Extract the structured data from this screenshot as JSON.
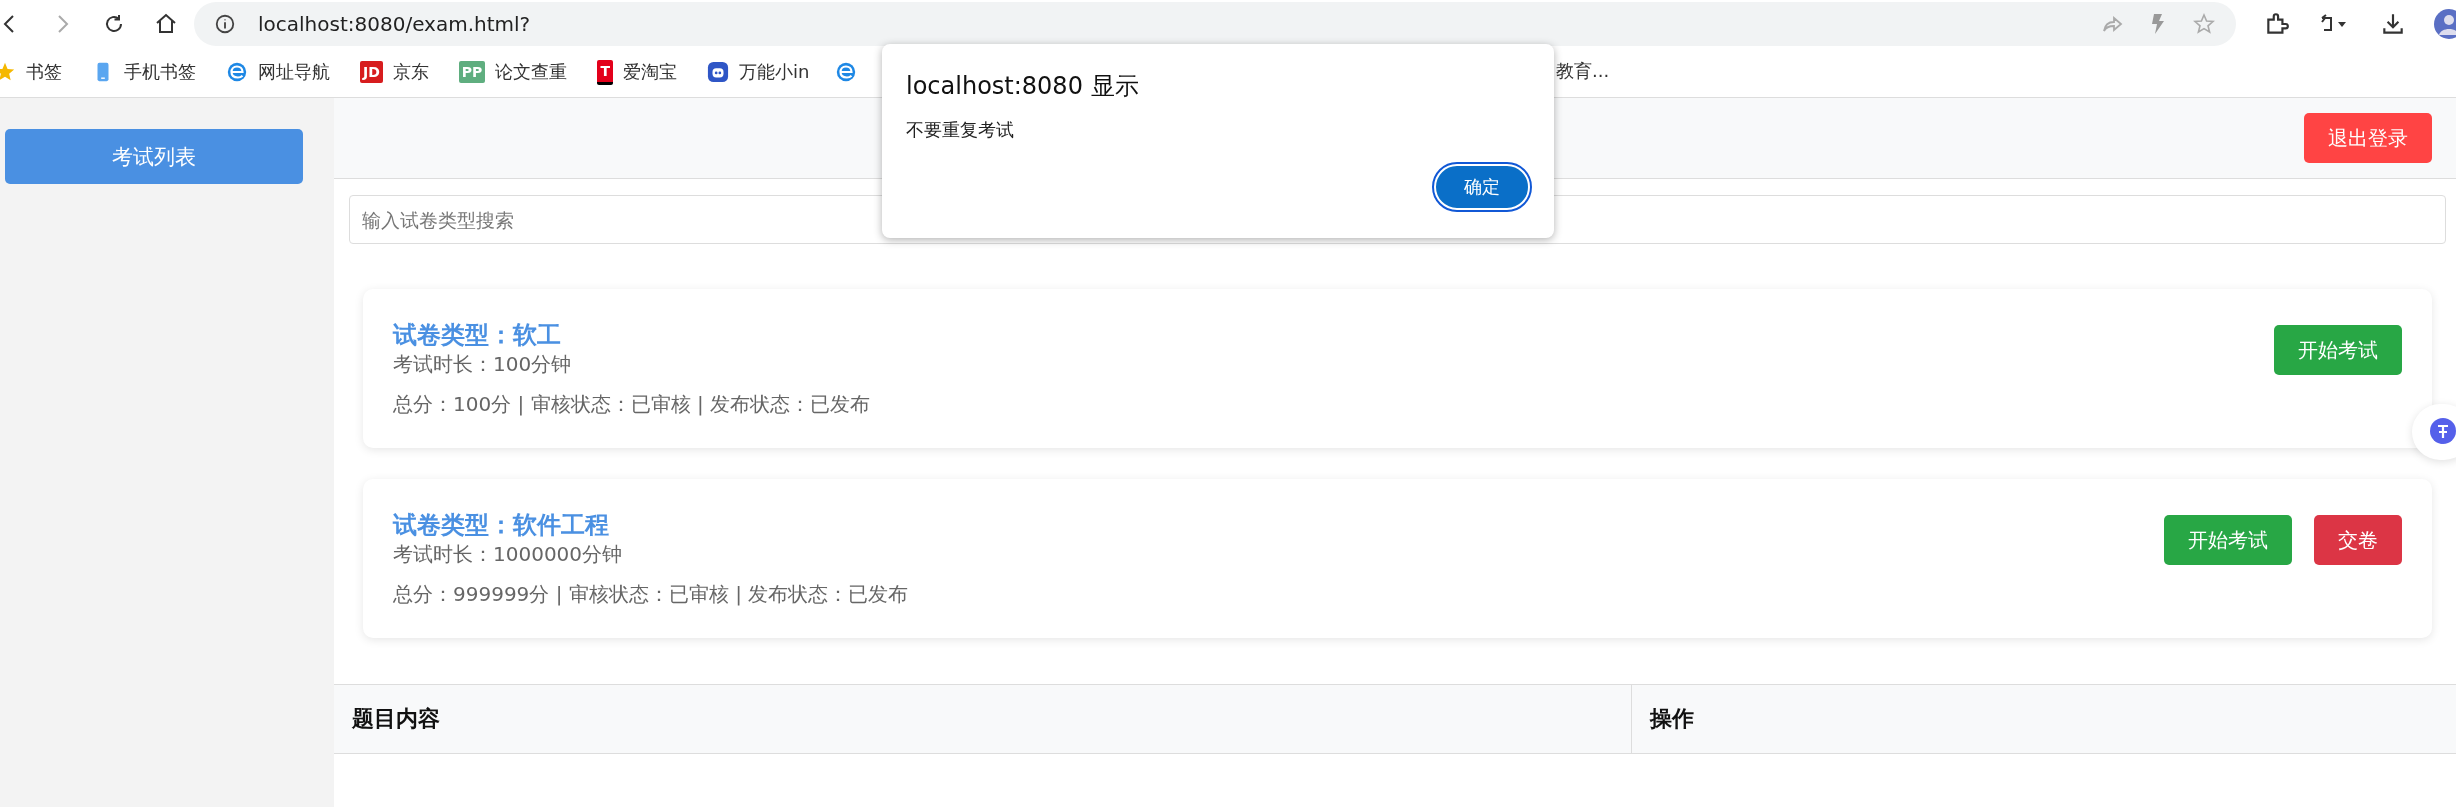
{
  "browser": {
    "url": "localhost:8080/exam.html?",
    "bookmarks": [
      {
        "label": "书签",
        "kind": "star"
      },
      {
        "label": "手机书签",
        "kind": "phone"
      },
      {
        "label": "网址导航",
        "kind": "edge"
      },
      {
        "label": "京东",
        "kind": "jd",
        "badge": "JD"
      },
      {
        "label": "论文查重",
        "kind": "pp",
        "badge": "PP"
      },
      {
        "label": "爱淘宝",
        "kind": "t",
        "badge": "T"
      },
      {
        "label": "万能小in",
        "kind": "robot"
      },
      {
        "label": "教育...",
        "kind": "edge"
      }
    ]
  },
  "dialog": {
    "title": "localhost:8080 显示",
    "message": "不要重复考试",
    "button": "确定"
  },
  "sidebar": {
    "items": [
      {
        "label": "考试列表",
        "selected": true
      }
    ]
  },
  "header": {
    "logout": "退出登录"
  },
  "search": {
    "placeholder": "输入试卷类型搜索"
  },
  "exams": [
    {
      "title": "试卷类型：软工",
      "duration": "考试时长：100分钟",
      "meta": "总分：100分 | 审核状态：已审核 | 发布状态：已发布",
      "buttons": [
        {
          "label": "开始考试",
          "kind": "start"
        }
      ]
    },
    {
      "title": "试卷类型：软件工程",
      "duration": "考试时长：1000000分钟",
      "meta": "总分：999999分 | 审核状态：已审核 | 发布状态：已发布",
      "buttons": [
        {
          "label": "开始考试",
          "kind": "start"
        },
        {
          "label": "交卷",
          "kind": "submit"
        }
      ]
    }
  ],
  "table": {
    "columns": [
      "题目内容",
      "操作"
    ]
  }
}
